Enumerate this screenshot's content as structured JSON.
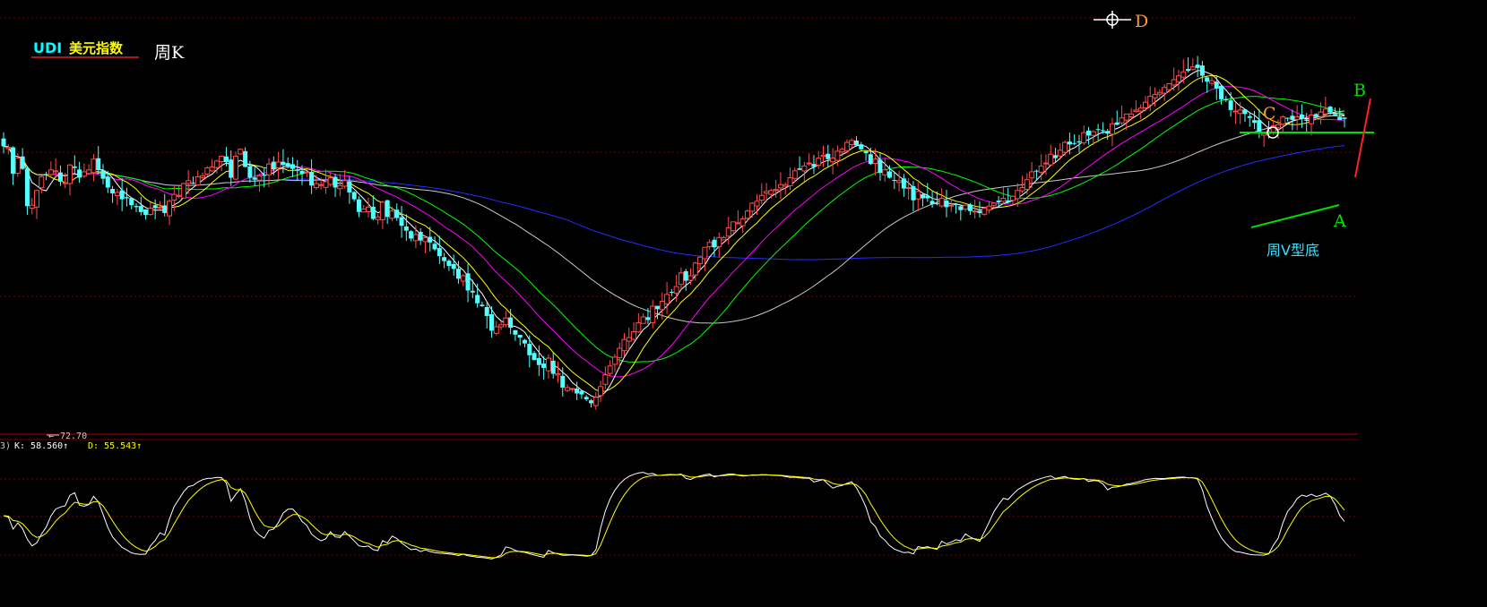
{
  "header": {
    "symbol": "UDI",
    "name": "美元指数",
    "period": "周K"
  },
  "annotations": {
    "D": "D",
    "C": "C",
    "B": "B",
    "A": "A",
    "pattern": "周V型底",
    "low_price": "72.70"
  },
  "kdj": {
    "prefix": "3)",
    "k_label": "K: 58.560↑",
    "d_label": "D: 55.543↑"
  },
  "colors": {
    "background": "#000000",
    "up": "#ff4b4b",
    "down": "#54ffff",
    "ma5": "#ffffff",
    "ma10": "#ffff00",
    "ma20": "#ff00ff",
    "ma30": "#00ff00",
    "ma60": "#c8c8c8",
    "ma120": "#2a2aff",
    "grid": "#8b0000"
  },
  "chart_data": [
    {
      "type": "candlestick",
      "low_marker": 72.7,
      "closes": [
        98.9,
        98.8,
        96.1,
        97.7,
        96.6,
        92.8,
        92.9,
        94.4,
        95.8,
        96.0,
        96.5,
        96.4,
        95.3,
        95.2,
        97.0,
        96.7,
        95.7,
        96.3,
        96.5,
        97.6,
        96.5,
        95.6,
        94.7,
        94.1,
        94.2,
        93.5,
        93.6,
        92.9,
        92.7,
        92.2,
        91.9,
        92.6,
        92.6,
        92.7,
        92.1,
        93.3,
        94.0,
        93.9,
        95.1,
        95.4,
        95.1,
        95.8,
        95.9,
        96.7,
        96.8,
        97.4,
        97.9,
        97.3,
        95.7,
        97.9,
        98.6,
        96.8,
        95.7,
        95.5,
        95.9,
        95.9,
        97.1,
        96.6,
        97.3,
        97.0,
        96.8,
        96.6,
        96.4,
        96.1,
        96.3,
        94.9,
        95.1,
        95.0,
        95.3,
        95.7,
        94.7,
        94.9,
        95.4,
        94.2,
        93.5,
        92.2,
        92.5,
        92.7,
        91.5,
        91.7,
        93.2,
        91.7,
        92.3,
        91.6,
        90.8,
        90.3,
        89.5,
        89.9,
        89.3,
        89.6,
        89.1,
        88.4,
        87.7,
        87.2,
        86.7,
        86.4,
        85.4,
        85.7,
        84.2,
        84.0,
        82.9,
        82.6,
        81.6,
        80.1,
        80.5,
        80.7,
        81.4,
        80.4,
        79.7,
        79.4,
        78.8,
        77.6,
        77.1,
        76.6,
        76.3,
        77.3,
        75.7,
        75.7,
        74.3,
        74.3,
        74.2,
        73.7,
        73.6,
        73.1,
        72.7,
        73.3,
        74.4,
        75.6,
        76.5,
        77.4,
        78.3,
        79.2,
        79.4,
        80.0,
        80.9,
        81.5,
        81.2,
        82.6,
        82.3,
        83.1,
        83.8,
        84.0,
        84.6,
        86.0,
        85.2,
        85.7,
        87.0,
        87.6,
        88.6,
        89.1,
        88.6,
        89.6,
        89.6,
        90.6,
        91.2,
        91.1,
        91.5,
        92.3,
        93.1,
        93.3,
        93.9,
        94.3,
        94.4,
        94.5,
        95.0,
        95.0,
        95.7,
        96.4,
        96.5,
        96.9,
        97.2,
        96.8,
        97.7,
        98.0,
        97.6,
        97.7,
        98.4,
        98.6,
        99.3,
        99.5,
        99.0,
        98.6,
        98.2,
        97.1,
        97.6,
        96.2,
        96.5,
        95.7,
        95.4,
        95.4,
        94.6,
        94.7,
        93.4,
        94.3,
        93.6,
        93.6,
        93.0,
        93.0,
        93.6,
        92.7,
        92.9,
        93.0,
        92.4,
        92.9,
        92.3,
        92.3,
        92.1,
        92.6,
        92.8,
        93.1,
        93.2,
        93.6,
        93.2,
        93.8,
        94.4,
        94.7,
        95.5,
        96.3,
        96.4,
        96.9,
        97.2,
        98.1,
        97.7,
        98.5,
        99.3,
        99.1,
        99.2,
        99.3,
        100.3,
        100.0,
        100.4,
        100.6,
        100.5,
        100.2,
        101.2,
        101.1,
        101.8,
        102.2,
        102.2,
        102.6,
        102.8,
        103.4,
        104.0,
        104.2,
        104.4,
        104.9,
        105.3,
        105.7,
        106.1,
        106.5,
        106.6,
        107.0,
        106.9,
        106.1,
        105.5,
        105.6,
        104.8,
        103.7,
        103.6,
        102.6,
        102.5,
        102.6,
        102.2,
        101.8,
        101.3,
        100.3,
        100.2,
        100.2,
        101.0,
        101.1,
        101.9,
        101.8,
        101.6,
        101.9,
        101.8,
        101.5,
        102.1,
        101.9,
        102.4,
        102.7,
        102.4,
        102.0,
        101.6,
        101.7
      ]
    },
    {
      "type": "line",
      "series": [
        {
          "name": "K",
          "current": 58.56
        },
        {
          "name": "D",
          "current": 55.543
        }
      ]
    }
  ]
}
